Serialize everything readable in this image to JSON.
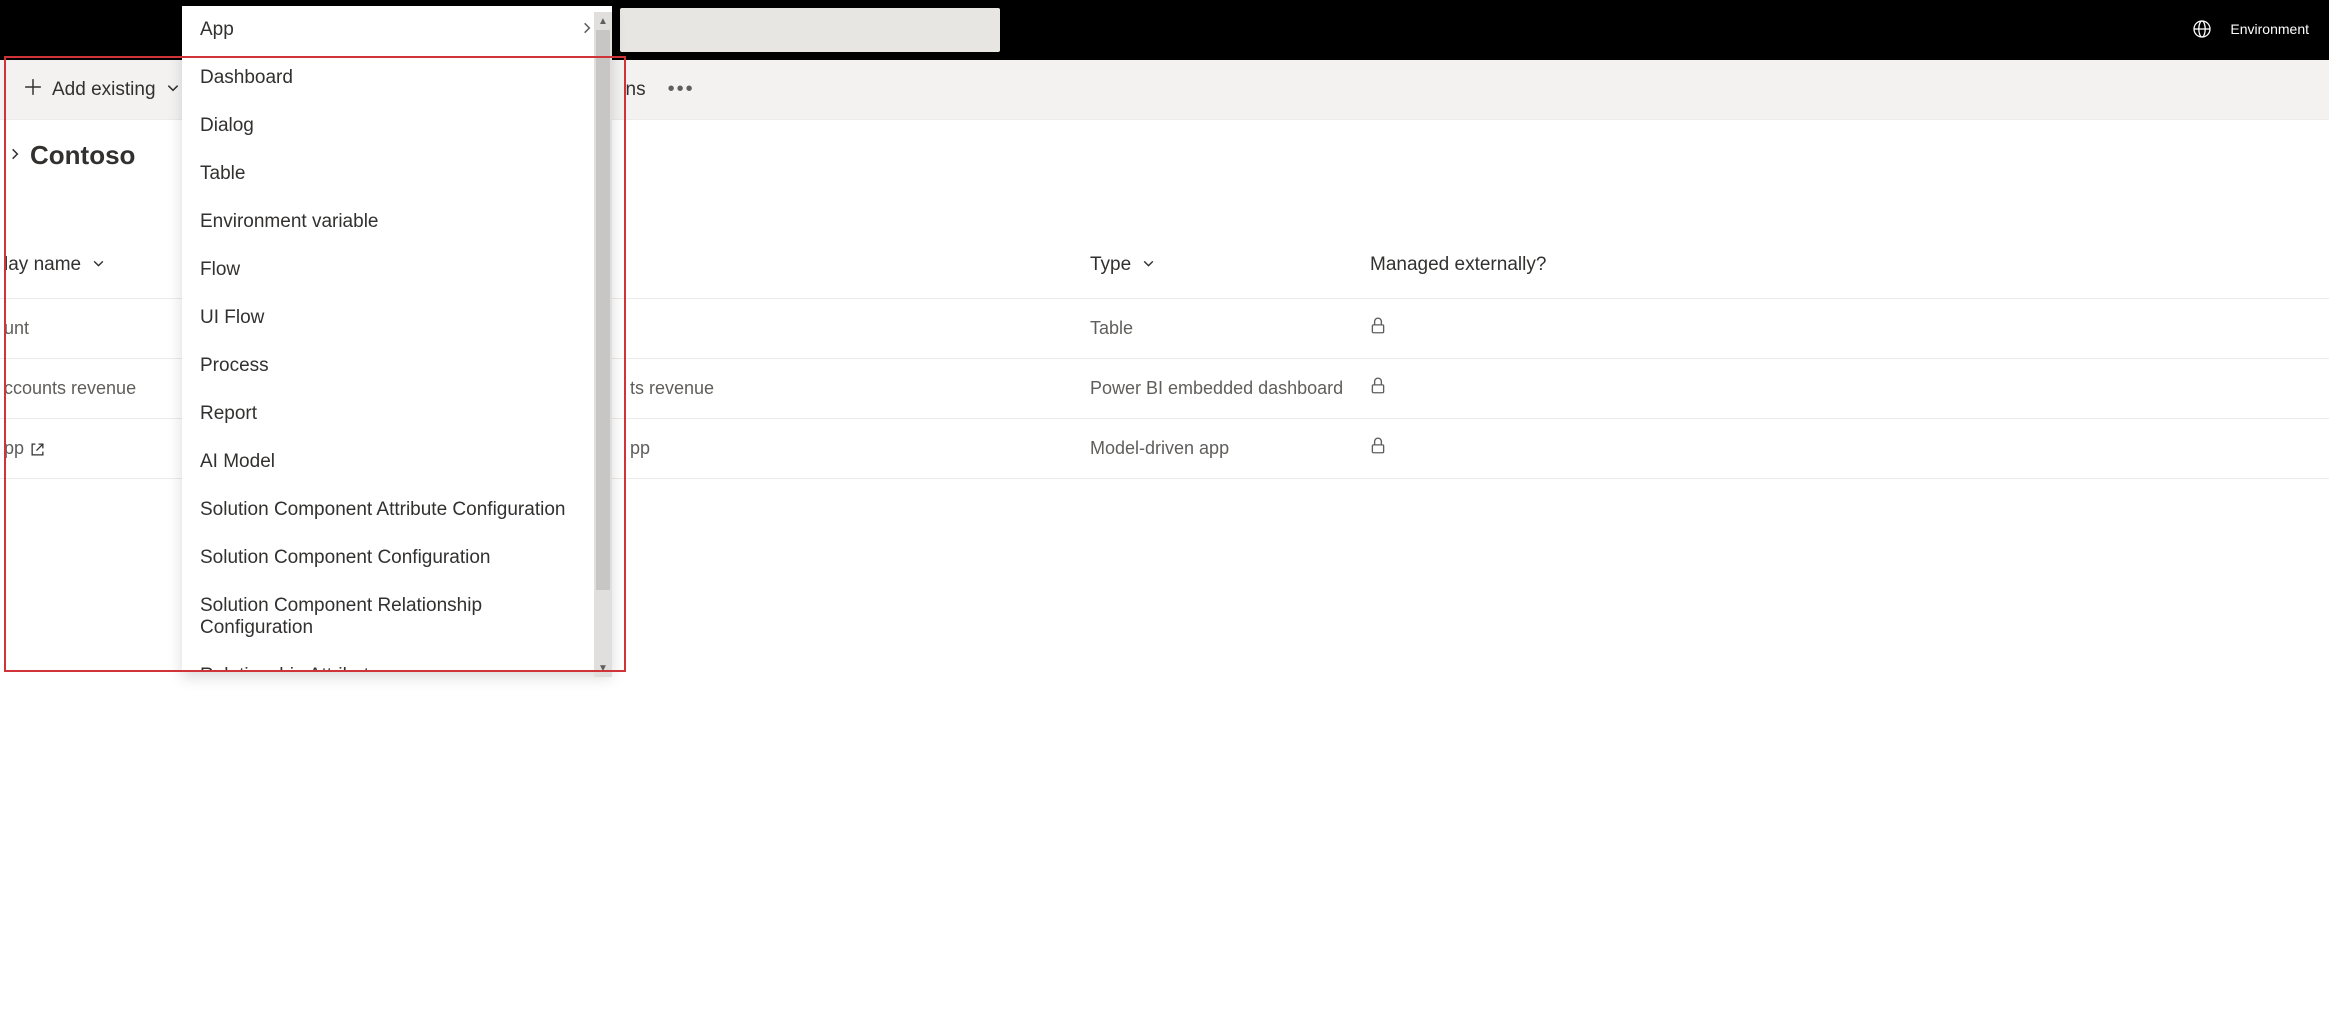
{
  "topbar": {
    "env_label": "Environment"
  },
  "commandbar": {
    "add_existing_label": "Add existing",
    "trail_label": "ns"
  },
  "page": {
    "title": "Contoso"
  },
  "table": {
    "columns": {
      "display_name": "lay name",
      "type": "Type",
      "managed": "Managed externally?"
    },
    "rows": [
      {
        "display": "unt",
        "name2": "",
        "type": "Table",
        "locked": true,
        "openlink": false
      },
      {
        "display": "ccounts revenue",
        "name2": "ts revenue",
        "type": "Power BI embedded dashboard",
        "locked": true,
        "openlink": false
      },
      {
        "display": "pp",
        "name2": "pp",
        "type": "Model-driven app",
        "locked": true,
        "openlink": true
      }
    ]
  },
  "dropdown": {
    "items": [
      {
        "label": "App",
        "has_submenu": true
      },
      {
        "label": "Dashboard",
        "has_submenu": false
      },
      {
        "label": "Dialog",
        "has_submenu": false
      },
      {
        "label": "Table",
        "has_submenu": false
      },
      {
        "label": "Environment variable",
        "has_submenu": false
      },
      {
        "label": "Flow",
        "has_submenu": false
      },
      {
        "label": "UI Flow",
        "has_submenu": false
      },
      {
        "label": "Process",
        "has_submenu": false
      },
      {
        "label": "Report",
        "has_submenu": false
      },
      {
        "label": "AI Model",
        "has_submenu": false
      },
      {
        "label": "Solution Component Attribute Configuration",
        "has_submenu": false
      },
      {
        "label": "Solution Component Configuration",
        "has_submenu": false
      },
      {
        "label": "Solution Component Relationship Configuration",
        "has_submenu": false
      },
      {
        "label": "Relationship Attribute",
        "has_submenu": false
      }
    ]
  }
}
